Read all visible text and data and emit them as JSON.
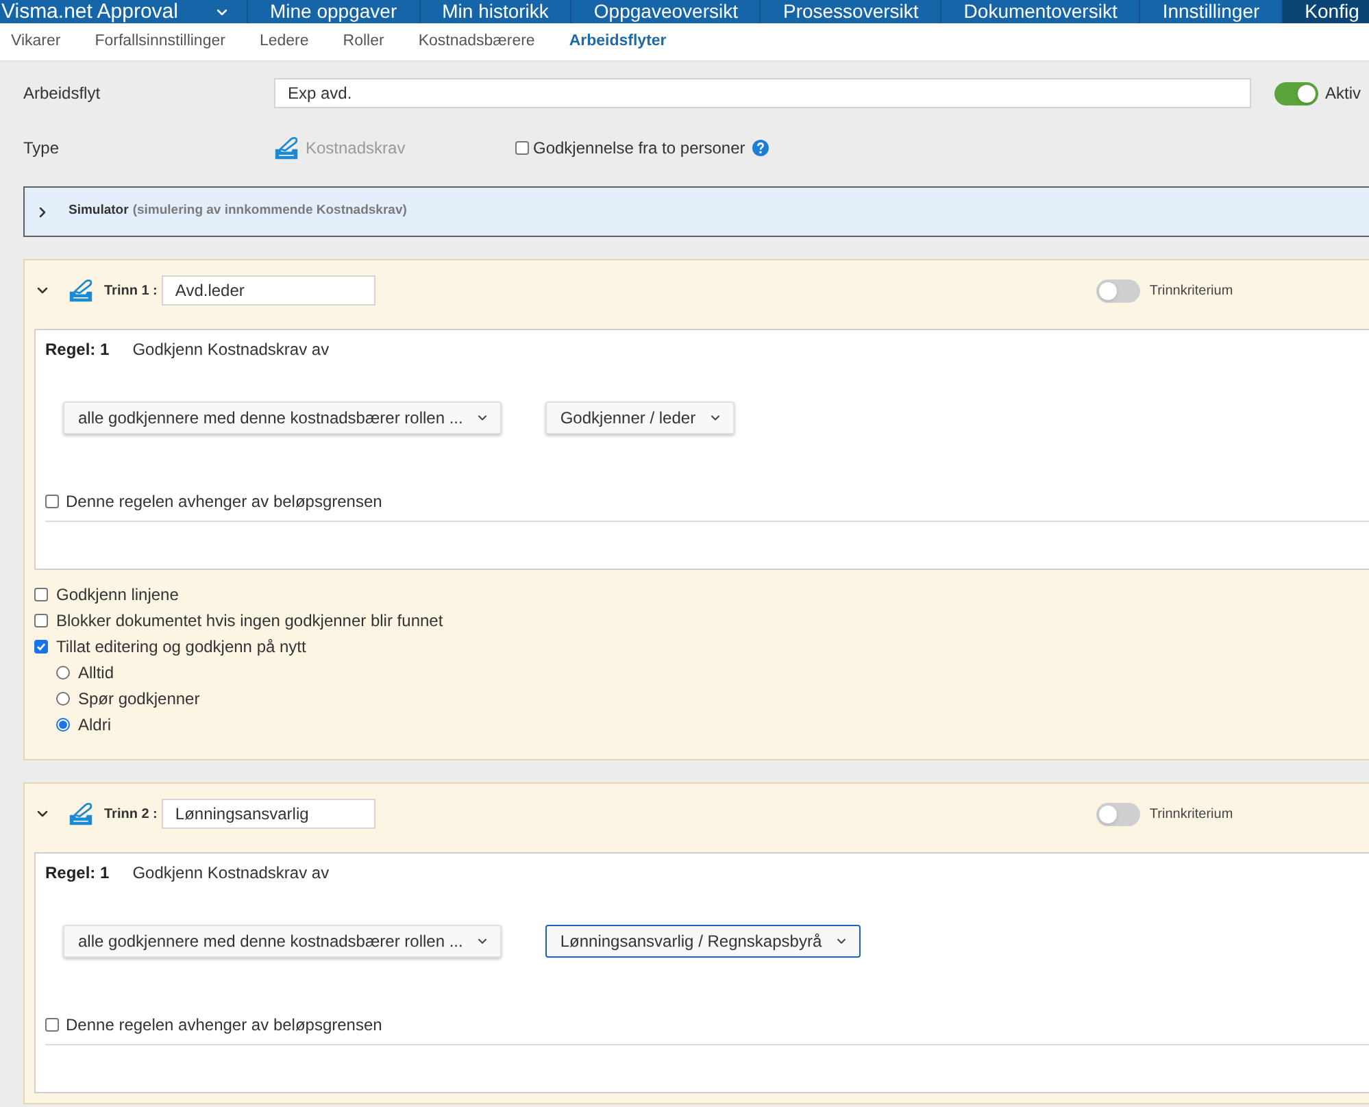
{
  "nav": {
    "brand": {
      "label": "Visma.net Approval"
    },
    "items": [
      {
        "label": "Mine oppgaver",
        "selected": false
      },
      {
        "label": "Min historikk",
        "selected": false
      },
      {
        "label": "Oppgaveoversikt",
        "selected": false
      },
      {
        "label": "Prosessoversikt",
        "selected": false
      },
      {
        "label": "Dokumentoversikt",
        "selected": false
      },
      {
        "label": "Innstillinger",
        "selected": false
      },
      {
        "label": "Konfig",
        "selected": true
      }
    ]
  },
  "subnav": [
    {
      "label": "Vikarer",
      "selected": false
    },
    {
      "label": "Forfallsinnstillinger",
      "selected": false
    },
    {
      "label": "Ledere",
      "selected": false
    },
    {
      "label": "Roller",
      "selected": false
    },
    {
      "label": "Kostnadsbærere",
      "selected": false
    },
    {
      "label": "Arbeidsflyter",
      "selected": true
    }
  ],
  "workflow": {
    "label": "Arbeidsflyt",
    "value": "Exp avd.",
    "active": {
      "label": "Aktiv",
      "on": true
    }
  },
  "type": {
    "label": "Type",
    "value": "Kostnadskrav",
    "two_person": {
      "label": "Godkjennelse fra to personer",
      "checked": false
    }
  },
  "simulator": {
    "title": "Simulator",
    "subtitle": "(simulering av innkommende Kostnadskrav)",
    "expanded": false
  },
  "steps": [
    {
      "label": "Trinn 1 :",
      "name": "Avd.leder",
      "expanded": true,
      "criterion": {
        "label": "Trinnkriterium",
        "on": false
      },
      "rules": [
        {
          "label": "Regel: 1",
          "text": "Godkjenn Kostnadskrav av",
          "selects": [
            {
              "value": "alle godkjennere med denne kostnadsbærer rollen ...",
              "focused": false
            },
            {
              "value": "Godkjenner / leder",
              "focused": false
            }
          ],
          "amount_limit": {
            "label": "Denne regelen avhenger av beløpsgrensen",
            "checked": false
          }
        }
      ],
      "options": [
        {
          "label": "Godkjenn linjene",
          "checked": false
        },
        {
          "label": "Blokker dokumentet hvis ingen godkjenner blir funnet",
          "checked": false
        },
        {
          "label": "Tillat editering og godkjenn på nytt",
          "checked": true,
          "modes": [
            {
              "label": "Alltid",
              "selected": false
            },
            {
              "label": "Spør godkjenner",
              "selected": false
            },
            {
              "label": "Aldri",
              "selected": true
            }
          ]
        }
      ]
    },
    {
      "label": "Trinn 2 :",
      "name": "Lønningsansvarlig",
      "expanded": true,
      "criterion": {
        "label": "Trinnkriterium",
        "on": false
      },
      "rules": [
        {
          "label": "Regel: 1",
          "text": "Godkjenn Kostnadskrav av",
          "selects": [
            {
              "value": "alle godkjennere med denne kostnadsbærer rollen ...",
              "focused": false
            },
            {
              "value": "Lønningsansvarlig / Regnskapsbyrå",
              "focused": true
            }
          ],
          "amount_limit": {
            "label": "Denne regelen avhenger av beløpsgrensen",
            "checked": false
          }
        }
      ]
    }
  ]
}
